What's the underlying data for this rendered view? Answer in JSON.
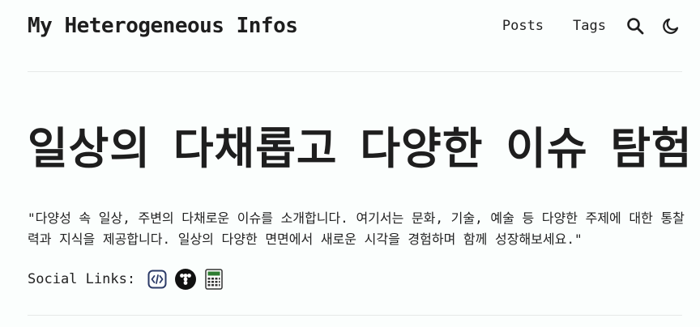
{
  "header": {
    "site_title": "My Heterogeneous Infos",
    "nav": {
      "posts_label": "Posts",
      "tags_label": "Tags"
    },
    "search_icon": "search-icon",
    "theme_icon": "moon-icon"
  },
  "hero": {
    "title": "일상의 다채롭고 다양한 이슈 탐험",
    "rss_icon": "rss-icon",
    "rss_color": "#1a6fb0"
  },
  "description": "\"다양성 속 일상, 주변의 다채로운 이슈를 소개합니다. 여기서는 문화, 기술, 예술 등 다양한 주제에 대한 통찰력과 지식을 제공합니다. 일상의 다양한 면면에서 새로운 시각을 경험하며 함께 성장해보세요.\"",
  "social": {
    "label": "Social Links:",
    "links": [
      {
        "icon": "code-icon",
        "color": "#2b3a67"
      },
      {
        "icon": "dots-icon",
        "color": "#111111"
      },
      {
        "icon": "calculator-icon",
        "color": "#444444"
      }
    ]
  }
}
